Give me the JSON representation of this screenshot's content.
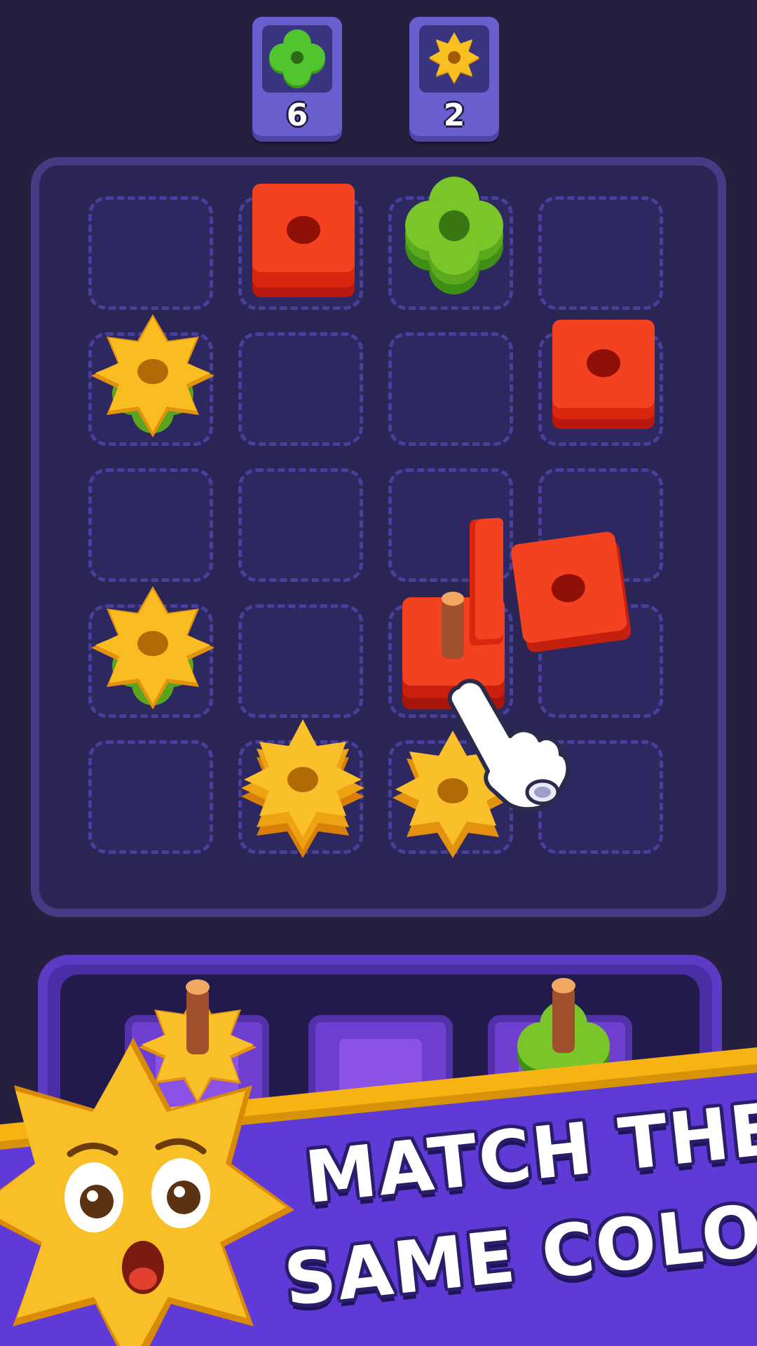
{
  "goals": [
    {
      "shape": "flower",
      "color": "#4fc02a",
      "count": "6"
    },
    {
      "shape": "gear",
      "color": "#f5b014",
      "count": "2"
    }
  ],
  "board": {
    "rows": 5,
    "cols": 4,
    "pieces": [
      {
        "row": 0,
        "col": 1,
        "shape": "square",
        "color": "#f23a1f",
        "stack": 2
      },
      {
        "row": 0,
        "col": 2,
        "shape": "flower",
        "color": "#73c226",
        "stack": 3
      },
      {
        "row": 1,
        "col": 0,
        "shape": "star",
        "color": "#f7b312",
        "stack": 1,
        "under": "flower"
      },
      {
        "row": 1,
        "col": 3,
        "shape": "square",
        "color": "#f23a1f",
        "stack": 2
      },
      {
        "row": 3,
        "col": 0,
        "shape": "star",
        "color": "#f7b312",
        "stack": 1,
        "under": "flower"
      },
      {
        "row": 3,
        "col": 2,
        "shape": "square",
        "color": "#f23a1f",
        "stack": 3,
        "peg": true
      },
      {
        "row": 4,
        "col": 1,
        "shape": "star",
        "color": "#f7b312",
        "stack": 3
      },
      {
        "row": 4,
        "col": 2,
        "shape": "star",
        "color": "#f7b312",
        "stack": 2
      }
    ]
  },
  "tray": {
    "slots": [
      {
        "content": "star",
        "color": "#f7b312"
      },
      {
        "content": "empty"
      },
      {
        "content": "flower",
        "color": "#73c226"
      }
    ]
  },
  "banner": {
    "line1": "MATCH THE",
    "line2": "SAME COLOR!"
  },
  "colors": {
    "background": "#25203f",
    "banner_purple": "#5f3ad6",
    "banner_stripe": "#f7b312",
    "red": "#f23a1f",
    "green": "#73c226",
    "yellow": "#f7b312"
  },
  "icons": {
    "hand": "pointing-hand-icon",
    "mascot": "star-mascot-icon"
  }
}
